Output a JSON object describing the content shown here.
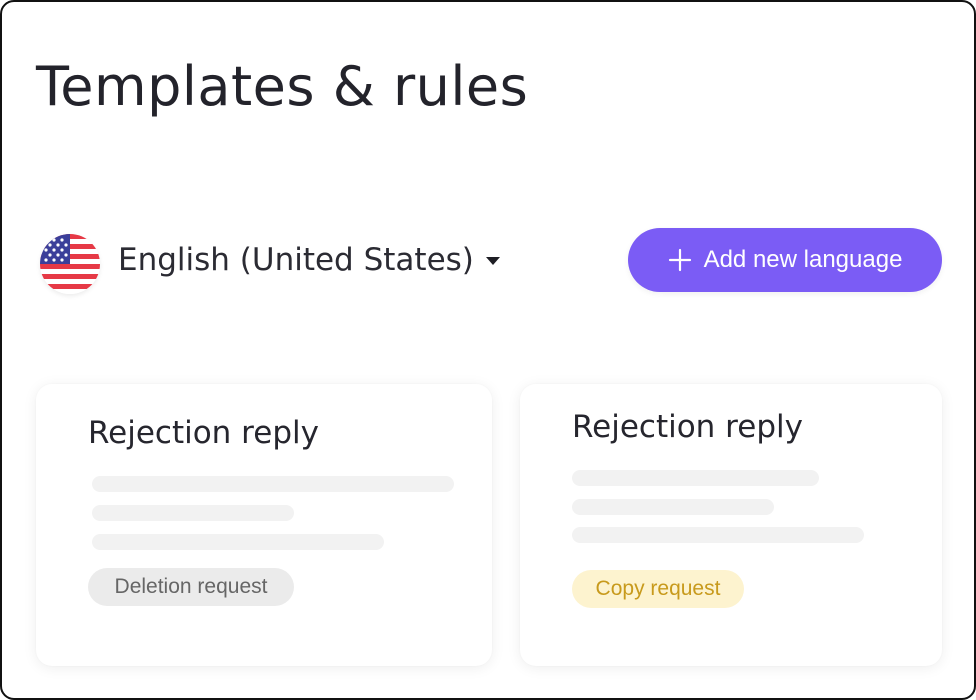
{
  "page": {
    "title": "Templates & rules"
  },
  "language": {
    "flag_icon": "us-flag-icon",
    "selected": "English (United States)",
    "dropdown_icon": "caret-down-icon"
  },
  "add_language_button": {
    "label": "Add new language",
    "icon": "plus-icon"
  },
  "cards": [
    {
      "title": "Rejection reply",
      "tag": "Deletion request",
      "tag_color": "#666666",
      "tag_background": "#ebebeb"
    },
    {
      "title": "Rejection reply",
      "tag": "Copy request",
      "tag_color": "#c89a1c",
      "tag_background": "#fdf3cf"
    }
  ],
  "colors": {
    "accent": "#7b5cf5",
    "text_primary": "#23232b",
    "placeholder": "#f2f2f2",
    "flag_red": "#e63946",
    "flag_blue": "#3b3f9a"
  }
}
